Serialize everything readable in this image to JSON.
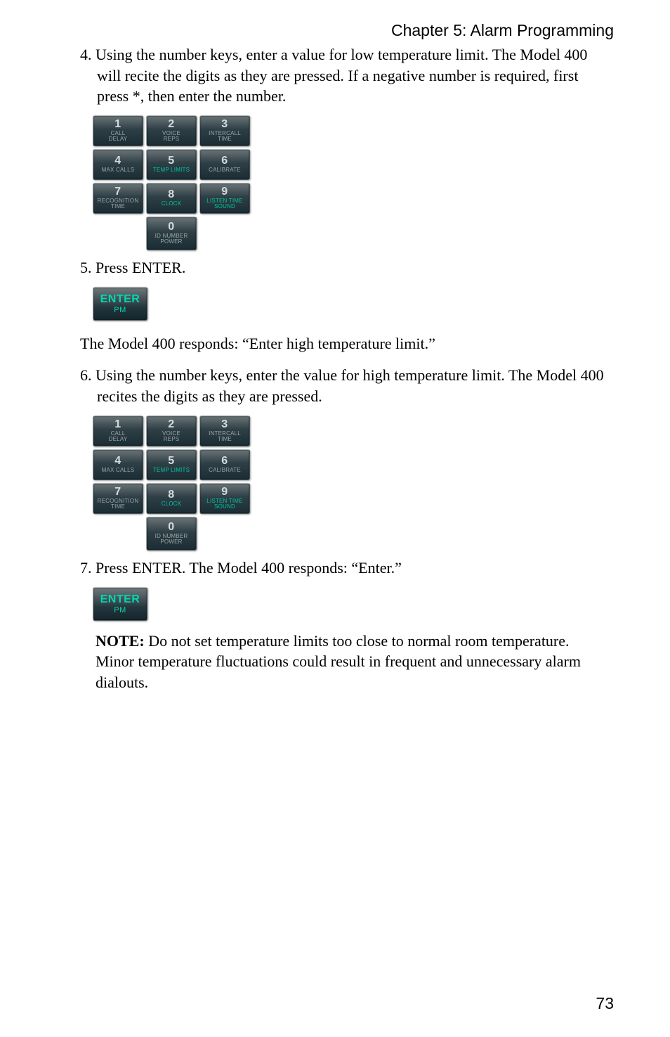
{
  "chapter_heading": "Chapter 5: Alarm Programming",
  "step4": "4. Using the number keys, enter a value for low temperature limit. The Model 400 will recite the digits as they are pressed. If a negative number is required, first press *, then enter the number.",
  "step5": "5. Press ENTER.",
  "response_line": "The Model 400 responds: “Enter high temperature limit.”",
  "step6": "6. Using the number keys, enter the value for high temperature limit. The Model 400 recites the digits as they are pressed.",
  "step7": "7. Press ENTER. The Model 400 responds: “Enter.”",
  "note_bold": "NOTE:",
  "note_rest": " Do not set temperature limits too close to normal room temperature. Minor temperature fluctuations could result in frequent and unnecessary alarm dialouts.",
  "keys": {
    "k1": {
      "num": "1",
      "label": "CALL\nDELAY"
    },
    "k2": {
      "num": "2",
      "label": "VOICE\nREPS"
    },
    "k3": {
      "num": "3",
      "label": "INTERCALL\nTIME"
    },
    "k4": {
      "num": "4",
      "label": "MAX CALLS"
    },
    "k5": {
      "num": "5",
      "label": "TEMP LIMITS"
    },
    "k6": {
      "num": "6",
      "label": "CALIBRATE"
    },
    "k7": {
      "num": "7",
      "label": "RECOGNITION\nTIME"
    },
    "k8": {
      "num": "8",
      "label": "CLOCK"
    },
    "k9": {
      "num": "9",
      "label": "LISTEN TIME\nSOUND"
    },
    "k0": {
      "num": "0",
      "label": "ID NUMBER\nPOWER"
    }
  },
  "enter": {
    "main": "ENTER",
    "sub": "PM"
  },
  "page_number": "73"
}
